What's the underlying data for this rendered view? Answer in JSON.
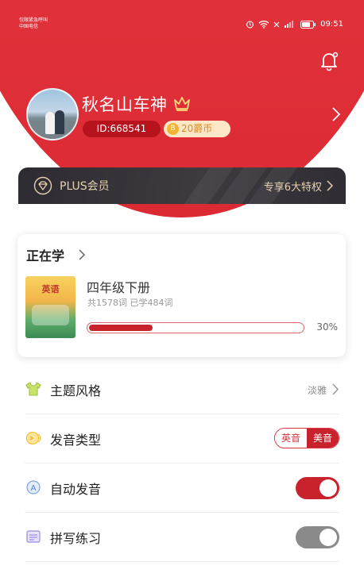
{
  "status_bar": {
    "carrier_line1": "仅限紧急呼叫",
    "carrier_line2": "中国电信",
    "time": "09:51"
  },
  "profile": {
    "username": "秋名山车神",
    "id_label": "ID:668541",
    "coins_label": "20爵币",
    "coin_icon": "B"
  },
  "plus": {
    "label": "PLUS会员",
    "right_label": "专享6大特权"
  },
  "learning": {
    "section_title": "正在学",
    "book_title": "英语",
    "grade": "四年级下册",
    "word_stats": "共1578词   已学484词",
    "progress_percent": 30,
    "progress_text": "30%"
  },
  "settings": {
    "theme": {
      "label": "主题风格",
      "value": "淡雅"
    },
    "pronunciation": {
      "label": "发音类型",
      "option_uk": "英音",
      "option_us": "美音",
      "selected": "美音"
    },
    "auto_play": {
      "label": "自动发音",
      "enabled": true
    },
    "spelling": {
      "label": "拼写练习",
      "enabled": false
    }
  },
  "colors": {
    "brand_red": "#e2343d",
    "accent_red": "#c8232c",
    "gold": "#e6d2ae"
  }
}
